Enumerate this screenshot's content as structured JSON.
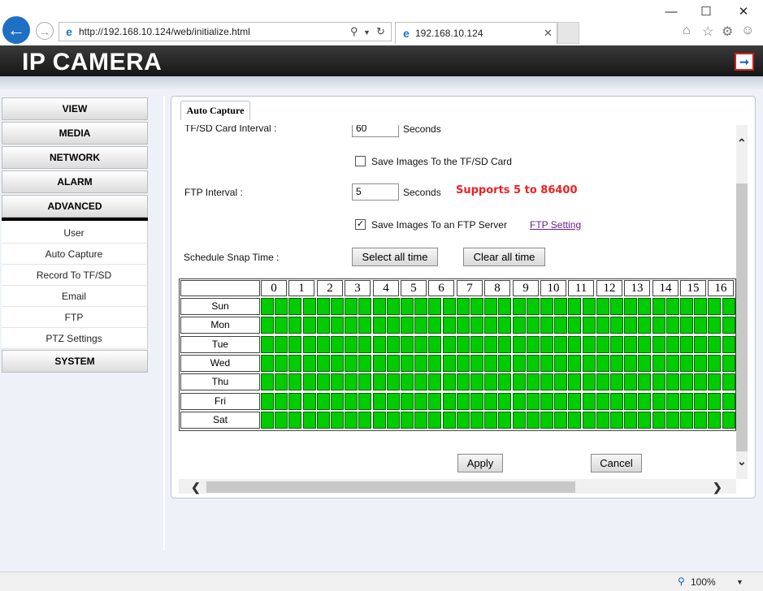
{
  "browser": {
    "url": "http://192.168.10.124/web/initialize.html",
    "tab_title": "192.168.10.124",
    "zoom": "100%"
  },
  "header": {
    "title": "IP CAMERA"
  },
  "sidebar": {
    "items": [
      {
        "label": "VIEW"
      },
      {
        "label": "MEDIA"
      },
      {
        "label": "NETWORK"
      },
      {
        "label": "ALARM"
      },
      {
        "label": "ADVANCED"
      },
      {
        "label": "SYSTEM"
      }
    ],
    "advanced_sub": [
      "User",
      "Auto Capture",
      "Record To TF/SD",
      "Email",
      "FTP",
      "PTZ Settings"
    ]
  },
  "panel": {
    "tab": "Auto Capture",
    "tf_interval_label": "TF/SD Card Interval :",
    "tf_interval_value": "60",
    "tf_seconds": "Seconds",
    "save_tf_label": "Save Images To the TF/SD Card",
    "save_tf_checked": false,
    "ftp_interval_label": "FTP Interval :",
    "ftp_interval_value": "5",
    "ftp_seconds": "Seconds",
    "ftp_note": "Supports 5 to 86400",
    "save_ftp_label": "Save Images To an FTP Server",
    "save_ftp_checked": true,
    "ftp_setting_link": "FTP Setting",
    "schedule_label": "Schedule Snap Time :",
    "select_all": "Select all time",
    "clear_all": "Clear all time",
    "apply": "Apply",
    "cancel": "Cancel"
  },
  "schedule": {
    "hours": [
      "0",
      "1",
      "2",
      "3",
      "4",
      "5",
      "6",
      "7",
      "8",
      "9",
      "10",
      "11",
      "12",
      "13",
      "14",
      "15",
      "16"
    ],
    "days": [
      "Sun",
      "Mon",
      "Tue",
      "Wed",
      "Thu",
      "Fri",
      "Sat"
    ],
    "all_selected": true,
    "selected_color": "#00cc00"
  },
  "colors": {
    "header_bg": "#1e1e1e",
    "alert": "#e22222",
    "link": "#6b1b8c"
  }
}
